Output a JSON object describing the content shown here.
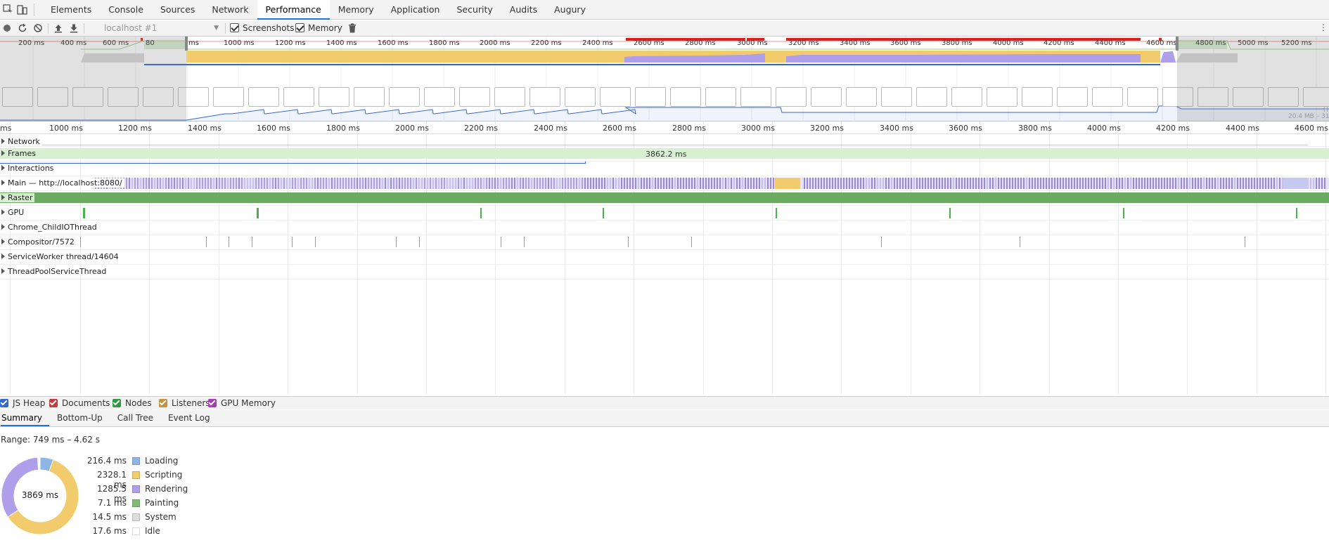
{
  "tabs": [
    {
      "label": "Elements"
    },
    {
      "label": "Console"
    },
    {
      "label": "Sources"
    },
    {
      "label": "Network"
    },
    {
      "label": "Performance",
      "active": true
    },
    {
      "label": "Memory"
    },
    {
      "label": "Application"
    },
    {
      "label": "Security"
    },
    {
      "label": "Audits"
    },
    {
      "label": "Augury"
    }
  ],
  "toolbar": {
    "profile_select": "localhost #1",
    "screenshots_label": "Screenshots",
    "memory_label": "Memory",
    "screenshots_checked": true,
    "memory_checked": true
  },
  "overview": {
    "ticks_left": [
      "200 ms",
      "400 ms",
      "600 ms",
      "80"
    ],
    "ticks": [
      "ms",
      "1000 ms",
      "1200 ms",
      "1400 ms",
      "1600 ms",
      "1800 ms",
      "2000 ms",
      "2200 ms",
      "2400 ms",
      "2600 ms",
      "2800 ms",
      "3000 ms",
      "3200 ms",
      "3400 ms",
      "3600 ms",
      "3800 ms",
      "4000 ms",
      "4200 ms",
      "4400 ms",
      "4600 ms"
    ],
    "ticks_right": [
      "4800 ms",
      "5000 ms",
      "5200 ms"
    ],
    "memory_range": "20.4 MB – 31.",
    "heap_abbrev": "H"
  },
  "main_ruler": [
    "ms",
    "1000 ms",
    "1200 ms",
    "1400 ms",
    "1600 ms",
    "1800 ms",
    "2000 ms",
    "2200 ms",
    "2400 ms",
    "2600 ms",
    "2800 ms",
    "3000 ms",
    "3200 ms",
    "3400 ms",
    "3600 ms",
    "3800 ms",
    "4000 ms",
    "4200 ms",
    "4400 ms",
    "4600 ms"
  ],
  "tracks": {
    "network": "Network",
    "frames": "Frames",
    "frames_duration": "3862.2 ms",
    "interactions": "Interactions",
    "main": "Main — http://localhost:8080/",
    "raster": "Raster",
    "gpu": "GPU",
    "childio": "Chrome_ChildIOThread",
    "compositor": "Compositor/7572",
    "serviceworker": "ServiceWorker thread/14604",
    "threadpool": "ThreadPoolServiceThread"
  },
  "memory_legend": [
    {
      "label": "JS Heap",
      "color": "#3367d6"
    },
    {
      "label": "Documents",
      "color": "#c6393e"
    },
    {
      "label": "Nodes",
      "color": "#2e9a3f"
    },
    {
      "label": "Listeners",
      "color": "#c6923a"
    },
    {
      "label": "GPU Memory",
      "color": "#a63cb6"
    }
  ],
  "bottom_tabs": [
    {
      "label": "Summary",
      "active": true
    },
    {
      "label": "Bottom-Up"
    },
    {
      "label": "Call Tree"
    },
    {
      "label": "Event Log"
    }
  ],
  "summary": {
    "range": "Range: 749 ms – 4.62 s",
    "total": "3869 ms",
    "categories": [
      {
        "value": "216.4 ms",
        "name": "Loading",
        "color": "#8fb5e4",
        "ms": 216.4
      },
      {
        "value": "2328.1 ms",
        "name": "Scripting",
        "color": "#f2cb6c",
        "ms": 2328.1
      },
      {
        "value": "1285.5 ms",
        "name": "Rendering",
        "color": "#af9fea",
        "ms": 1285.5
      },
      {
        "value": "7.1 ms",
        "name": "Painting",
        "color": "#80bb74",
        "ms": 7.1
      },
      {
        "value": "14.5 ms",
        "name": "System",
        "color": "#dddddd",
        "ms": 14.5
      },
      {
        "value": "17.6 ms",
        "name": "Idle",
        "color": "#ffffff",
        "ms": 17.6
      }
    ]
  },
  "colors": {
    "scripting": "#f2cb6c",
    "rendering": "#af9fea",
    "painting": "#80bb74",
    "frames": "#d7f0d1",
    "raster": "#6aab5f",
    "heap_line": "#3367d6",
    "long_task": "#e0201f",
    "accent": "#1a73e8"
  }
}
